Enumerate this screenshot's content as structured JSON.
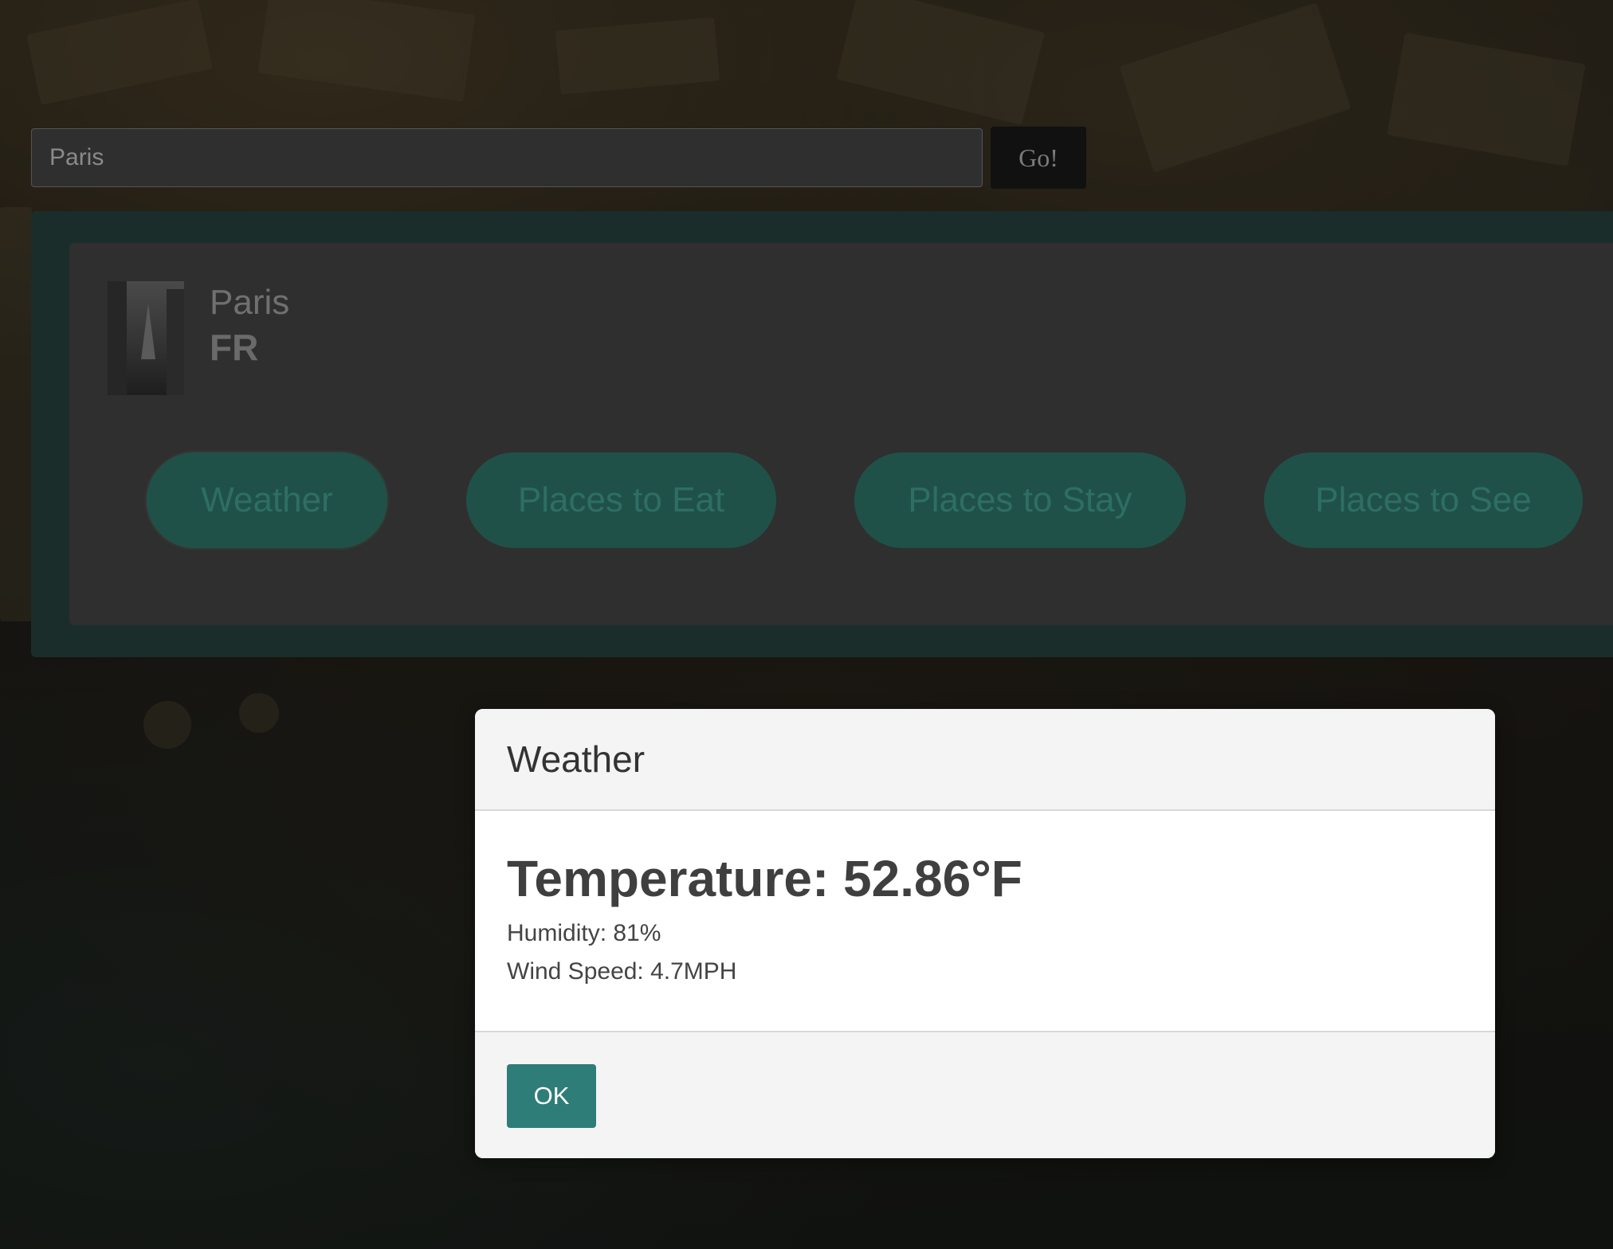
{
  "search": {
    "value": "Paris",
    "go_label": "Go!"
  },
  "city": {
    "name": "Paris",
    "country": "FR",
    "thumbnail_icon": "eiffel-tower-photo"
  },
  "categories": [
    {
      "label": "Weather"
    },
    {
      "label": "Places to Eat"
    },
    {
      "label": "Places to Stay"
    },
    {
      "label": "Places to See"
    }
  ],
  "modal": {
    "title": "Weather",
    "temperature": "Temperature: 52.86°F",
    "humidity": "Humidity: 81%",
    "wind_speed": "Wind Speed: 4.7MPH",
    "ok_label": "OK"
  },
  "colors": {
    "accent": "#2e7d78",
    "pill_bg": "#1f5149",
    "card_frame": "#1a2d2a"
  }
}
